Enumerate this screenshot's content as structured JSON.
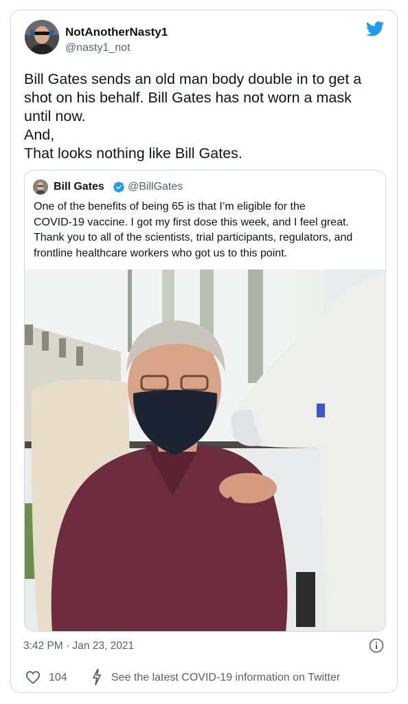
{
  "author": {
    "name": "NotAnotherNasty1",
    "handle": "@nasty1_not"
  },
  "tweet_lines": [
    "Bill Gates sends an old man body double in to get a",
    "shot on his behalf. Bill Gates has not worn a mask",
    "until now.",
    "And,",
    "That looks nothing like Bill Gates."
  ],
  "quoted": {
    "name": "Bill Gates",
    "handle": "@BillGates",
    "lines": [
      "One of the benefits of being 65 is that I’m eligible for the",
      "COVID-19 vaccine. I got my first dose this week, and I feel great.",
      "Thank you to all of the scientists, trial participants, regulators, and",
      "frontline healthcare workers who got us to this point."
    ]
  },
  "meta": {
    "timestamp": "3:42 PM · Jan 23, 2021",
    "likes": "104",
    "covid_link": "See the latest COVID-19 information on Twitter"
  },
  "colors": {
    "twitter_blue": "#1d9bf0",
    "secondary_text": "#536471",
    "border": "#cfd9de"
  },
  "icons": [
    "twitter-bird-icon",
    "verified-badge-icon",
    "info-icon",
    "heart-icon",
    "lightning-bolt-icon"
  ]
}
